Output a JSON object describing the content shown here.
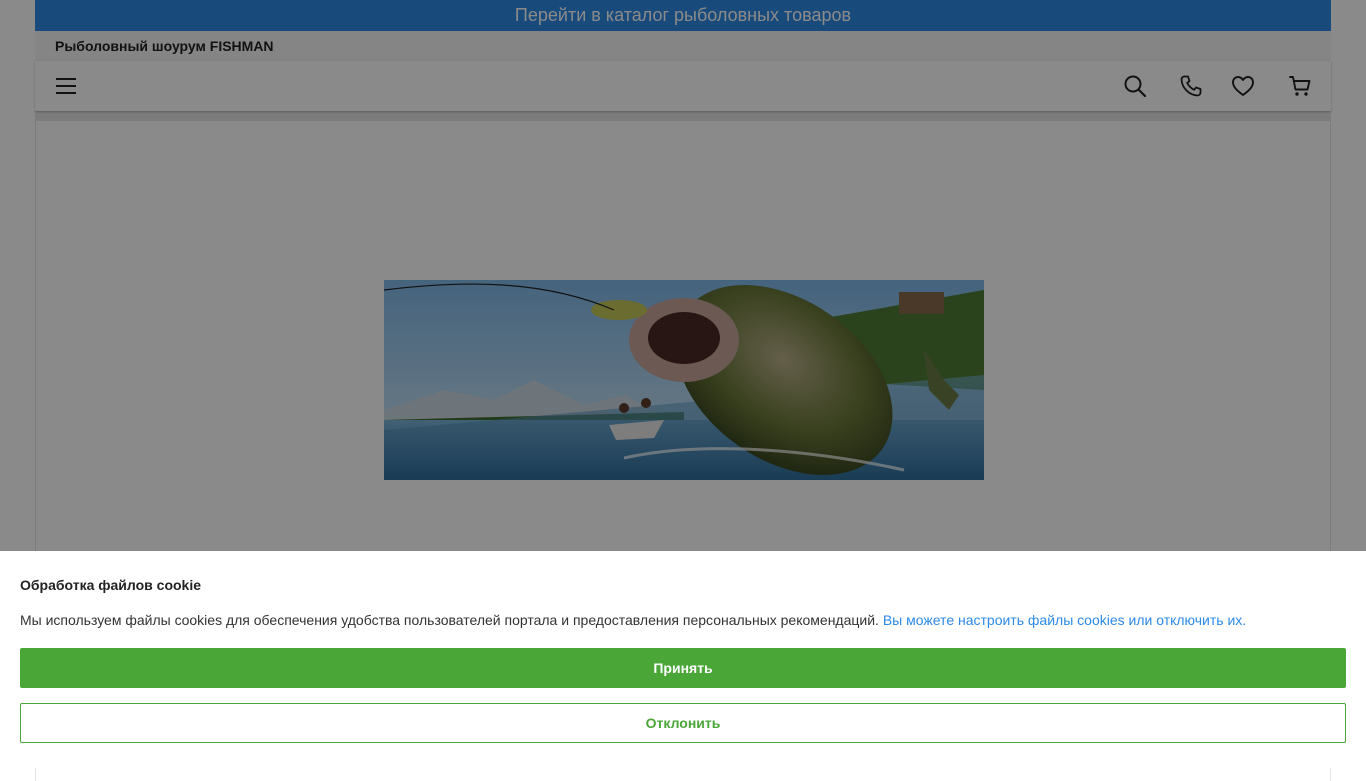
{
  "promo_bar": {
    "text": "Перейти в каталог рыболовных товаров"
  },
  "shop": {
    "title": "Рыболовный шоурум FISHMAN"
  },
  "nav": {
    "icons": [
      "menu-icon",
      "search-icon",
      "phone-icon",
      "heart-icon",
      "cart-icon"
    ]
  },
  "hero": {
    "image": "fishing-banner-bass-jumping"
  },
  "cookie_banner": {
    "title": "Обработка файлов cookie",
    "text": "Мы используем файлы cookies для обеспечения удобства пользователей портала и предоставления персональных рекомендаций.",
    "link_text": "Вы можете настроить файлы cookies или отключить их.",
    "accept_label": "Принять",
    "decline_label": "Отклонить"
  },
  "colors": {
    "accent_blue": "#2d8ae6",
    "accept_green": "#4aa637",
    "overlay": "rgba(0,0,0,0.46)"
  }
}
